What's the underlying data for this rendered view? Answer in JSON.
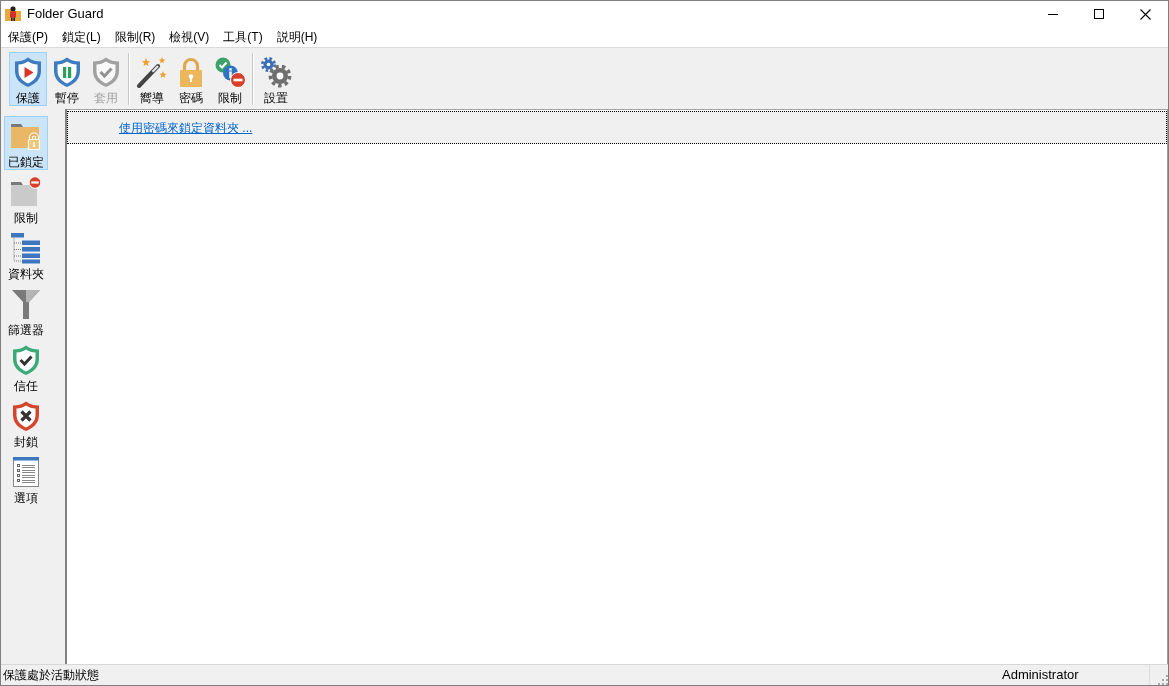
{
  "window": {
    "title": "Folder Guard"
  },
  "menu": [
    "保護(P)",
    "鎖定(L)",
    "限制(R)",
    "檢視(V)",
    "工具(T)",
    "説明(H)"
  ],
  "toolbar": {
    "groups": [
      [
        {
          "label": "保護",
          "kind": "protect",
          "selected": true,
          "disabled": false
        },
        {
          "label": "暫停",
          "kind": "pause",
          "selected": false,
          "disabled": false
        },
        {
          "label": "套用",
          "kind": "apply",
          "selected": false,
          "disabled": true
        }
      ],
      [
        {
          "label": "嚮導",
          "kind": "wizard",
          "selected": false,
          "disabled": false
        },
        {
          "label": "密碼",
          "kind": "password",
          "selected": false,
          "disabled": false
        },
        {
          "label": "限制",
          "kind": "restrict",
          "selected": false,
          "disabled": false
        }
      ],
      [
        {
          "label": "設置",
          "kind": "settings",
          "selected": false,
          "disabled": false
        }
      ]
    ]
  },
  "sidebar": {
    "items": [
      {
        "label": "已鎖定",
        "kind": "locked",
        "selected": true
      },
      {
        "label": "限制",
        "kind": "restricted",
        "selected": false
      },
      {
        "label": "資料夾",
        "kind": "folders",
        "selected": false
      },
      {
        "label": "篩選器",
        "kind": "filters",
        "selected": false
      },
      {
        "label": "信任",
        "kind": "trusted",
        "selected": false
      },
      {
        "label": "封鎖",
        "kind": "blocked",
        "selected": false
      },
      {
        "label": "選項",
        "kind": "options",
        "selected": false
      }
    ]
  },
  "banner": {
    "link": "使用密碼來鎖定資料夾 ..."
  },
  "status_bar": {
    "message": "保護處於活動狀態",
    "user": "Administrator"
  }
}
